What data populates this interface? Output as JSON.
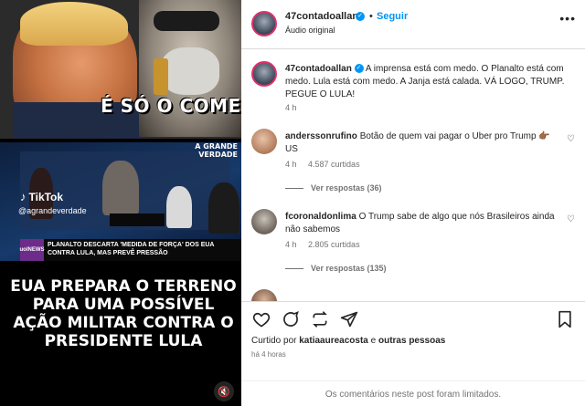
{
  "media": {
    "caption_top": "É SÓ O COMEÇO",
    "badge_verdade": "A GRANDE\nVERDADE",
    "tiktok_label": "TikTok",
    "tiktok_handle": "@agrandeverdade",
    "news_logo": "uolNEWS",
    "news_ticker": "PLANALTO DESCARTA 'MEDIDA DE FORÇA' DOS EUA CONTRA LULA, MAS PREVÊ PRESSÃO",
    "caption_bottom": "EUA PREPARA O TERRENO PARA UMA POSSÍVEL AÇÃO MILITAR CONTRA O PRESIDENTE LULA"
  },
  "header": {
    "username": "47contadoallan",
    "follow_label": "Seguir",
    "audio_label": "Áudio original",
    "separator": "•"
  },
  "caption": {
    "username": "47contadoallan",
    "text": "A imprensa está com medo. O Planalto está com medo. Lula está com medo. A Janja está calada. VÁ LOGO, TRUMP. PEGUE O LULA!",
    "time": "4 h"
  },
  "comments": [
    {
      "username": "anderssonrufino",
      "text": "Botão de quem vai pagar o Uber pro Trump",
      "suffix": "US",
      "time": "4 h",
      "likes": "4.587 curtidas",
      "replies": "Ver respostas (36)"
    },
    {
      "username": "fcoronaldonlima",
      "text": "O Trump sabe de algo que nós Brasileiros ainda não sabemos",
      "time": "4 h",
      "likes": "2.805 curtidas",
      "replies": "Ver respostas (135)"
    }
  ],
  "actions": {
    "liked_prefix": "Curtido por",
    "liked_user": "katiaaureacosta",
    "liked_suffix": "e",
    "liked_others": "outras pessoas",
    "ago": "há 4 horas",
    "limited": "Os comentários neste post foram limitados."
  },
  "colors": {
    "accent_blue": "#0095f6",
    "ring": "#e1306c",
    "text": "#262626",
    "muted": "#737373"
  },
  "icons": [
    "more-icon",
    "verified-icon",
    "heart-icon",
    "comment-icon",
    "repost-icon",
    "share-icon",
    "bookmark-icon",
    "mute-icon"
  ]
}
